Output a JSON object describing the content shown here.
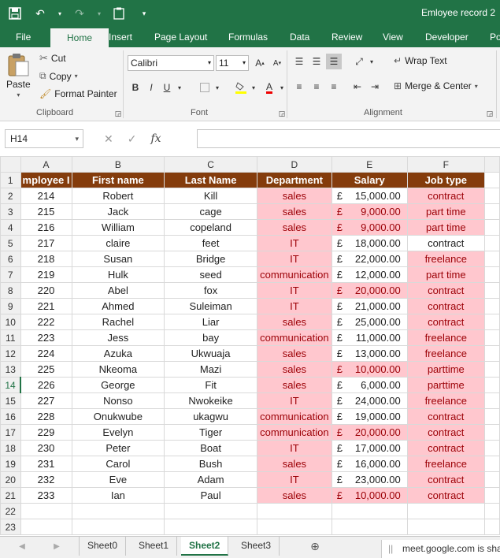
{
  "window": {
    "title": "Emloyee record 2"
  },
  "ribbon_tabs": [
    "File",
    "Home",
    "Insert",
    "Page Layout",
    "Formulas",
    "Data",
    "Review",
    "View",
    "Developer",
    "Po"
  ],
  "clipboard": {
    "paste": "Paste",
    "cut": "Cut",
    "copy": "Copy",
    "format_painter": "Format Painter",
    "label": "Clipboard"
  },
  "font": {
    "name": "Calibri",
    "size": "11",
    "bold": "B",
    "italic": "I",
    "label": "Font"
  },
  "alignment": {
    "wrap_text": "Wrap Text",
    "merge_center": "Merge & Center",
    "label": "Alignment"
  },
  "formula_bar": {
    "name_box": "H14",
    "fx": "fx",
    "value": ""
  },
  "columns": [
    "A",
    "B",
    "C",
    "D",
    "E",
    "F"
  ],
  "header_row": [
    "mployee I",
    "First name",
    "Last Name",
    "Department",
    "Salary",
    "Job type"
  ],
  "rows": [
    {
      "id": "214",
      "first": "Robert",
      "last": "Kill",
      "dept": "sales",
      "salary": "15,000.00",
      "job": "contract",
      "dept_hl": true,
      "sal_hl": false,
      "job_hl": true
    },
    {
      "id": "215",
      "first": "Jack",
      "last": "cage",
      "dept": "sales",
      "salary": "9,000.00",
      "job": "part time",
      "dept_hl": true,
      "sal_hl": true,
      "job_hl": true
    },
    {
      "id": "216",
      "first": "William",
      "last": "copeland",
      "dept": "sales",
      "salary": "9,000.00",
      "job": "part time",
      "dept_hl": true,
      "sal_hl": true,
      "job_hl": true
    },
    {
      "id": "217",
      "first": "claire",
      "last": "feet",
      "dept": "IT",
      "salary": "18,000.00",
      "job": "contract",
      "dept_hl": true,
      "sal_hl": false,
      "job_hl": false
    },
    {
      "id": "218",
      "first": "Susan",
      "last": "Bridge",
      "dept": "IT",
      "salary": "22,000.00",
      "job": "freelance",
      "dept_hl": true,
      "sal_hl": false,
      "job_hl": true
    },
    {
      "id": "219",
      "first": "Hulk",
      "last": "seed",
      "dept": "communication",
      "salary": "12,000.00",
      "job": "part time",
      "dept_hl": true,
      "sal_hl": false,
      "job_hl": true
    },
    {
      "id": "220",
      "first": "Abel",
      "last": "fox",
      "dept": "IT",
      "salary": "20,000.00",
      "job": "contract",
      "dept_hl": true,
      "sal_hl": true,
      "job_hl": true
    },
    {
      "id": "221",
      "first": "Ahmed",
      "last": "Suleiman",
      "dept": "IT",
      "salary": "21,000.00",
      "job": "contract",
      "dept_hl": true,
      "sal_hl": false,
      "job_hl": true
    },
    {
      "id": "222",
      "first": "Rachel",
      "last": "Liar",
      "dept": "sales",
      "salary": "25,000.00",
      "job": "contract",
      "dept_hl": true,
      "sal_hl": false,
      "job_hl": true
    },
    {
      "id": "223",
      "first": "Jess",
      "last": "bay",
      "dept": "communication",
      "salary": "11,000.00",
      "job": "freelance",
      "dept_hl": true,
      "sal_hl": false,
      "job_hl": true
    },
    {
      "id": "224",
      "first": "Azuka",
      "last": "Ukwuaja",
      "dept": "sales",
      "salary": "13,000.00",
      "job": "freelance",
      "dept_hl": true,
      "sal_hl": false,
      "job_hl": true
    },
    {
      "id": "225",
      "first": "Nkeoma",
      "last": "Mazi",
      "dept": "sales",
      "salary": "10,000.00",
      "job": "parttime",
      "dept_hl": true,
      "sal_hl": true,
      "job_hl": true
    },
    {
      "id": "226",
      "first": "George",
      "last": "Fit",
      "dept": "sales",
      "salary": "6,000.00",
      "job": "parttime",
      "dept_hl": true,
      "sal_hl": false,
      "job_hl": true
    },
    {
      "id": "227",
      "first": "Nonso",
      "last": "Nwokeike",
      "dept": "IT",
      "salary": "24,000.00",
      "job": "freelance",
      "dept_hl": true,
      "sal_hl": false,
      "job_hl": true
    },
    {
      "id": "228",
      "first": "Onukwube",
      "last": "ukagwu",
      "dept": "communication",
      "salary": "19,000.00",
      "job": "contract",
      "dept_hl": true,
      "sal_hl": false,
      "job_hl": true
    },
    {
      "id": "229",
      "first": "Evelyn",
      "last": "Tiger",
      "dept": "communication",
      "salary": "20,000.00",
      "job": "contract",
      "dept_hl": true,
      "sal_hl": true,
      "job_hl": true
    },
    {
      "id": "230",
      "first": "Peter",
      "last": "Boat",
      "dept": "IT",
      "salary": "17,000.00",
      "job": "contract",
      "dept_hl": true,
      "sal_hl": false,
      "job_hl": true
    },
    {
      "id": "231",
      "first": "Carol",
      "last": "Bush",
      "dept": "sales",
      "salary": "16,000.00",
      "job": "freelance",
      "dept_hl": true,
      "sal_hl": false,
      "job_hl": true
    },
    {
      "id": "232",
      "first": "Eve",
      "last": "Adam",
      "dept": "IT",
      "salary": "23,000.00",
      "job": "contract",
      "dept_hl": true,
      "sal_hl": false,
      "job_hl": true
    },
    {
      "id": "233",
      "first": "Ian",
      "last": "Paul",
      "dept": "sales",
      "salary": "10,000.00",
      "job": "contract",
      "dept_hl": true,
      "sal_hl": true,
      "job_hl": true
    }
  ],
  "currency_symbol": "£",
  "row_numbers": [
    "1",
    "2",
    "3",
    "4",
    "5",
    "6",
    "7",
    "8",
    "9",
    "10",
    "11",
    "12",
    "13",
    "14",
    "15",
    "16",
    "17",
    "18",
    "19",
    "20",
    "21",
    "22",
    "23"
  ],
  "selected_row": "14",
  "sheets": [
    "Sheet0",
    "Sheet1",
    "Sheet2",
    "Sheet3"
  ],
  "active_sheet": "Sheet2",
  "notice": "meet.google.com is sha",
  "colors": {
    "excel_green": "#217346",
    "header_brown": "#843c0c",
    "highlight_fill": "#ffc7ce",
    "highlight_text": "#9c0006"
  }
}
